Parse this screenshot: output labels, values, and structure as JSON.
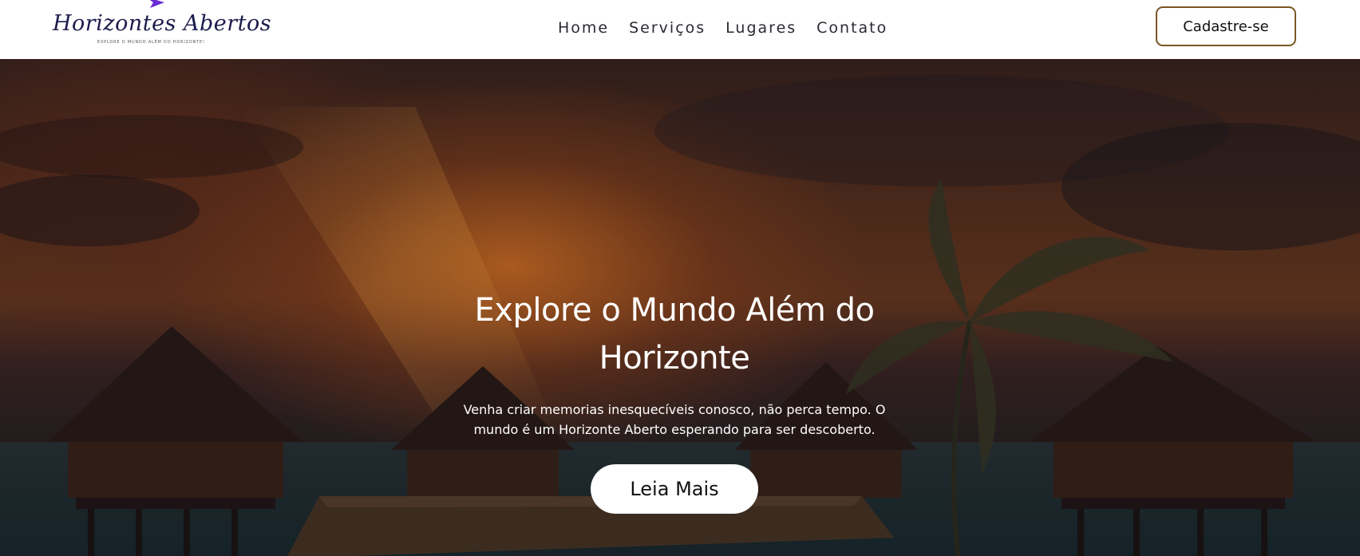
{
  "brand": {
    "name": "Horizontes Abertos",
    "tagline": "Explore o mundo além do horizonte!"
  },
  "nav": {
    "items": [
      "Home",
      "Serviços",
      "Lugares",
      "Contato"
    ]
  },
  "header": {
    "cta_label": "Cadastre-se"
  },
  "hero": {
    "title": "Explore o Mundo Além do Horizonte",
    "subtitle": "Venha criar memorias inesquecíveis conosco, não perca tempo. O mundo é um Horizonte Aberto esperando para ser descoberto.",
    "cta_label": "Leia Mais"
  },
  "colors": {
    "brand_navy": "#1d1b4c",
    "brand_purple": "#6a2bd6",
    "header_cta_border": "#7a5526",
    "hero_text": "#ffffff"
  }
}
